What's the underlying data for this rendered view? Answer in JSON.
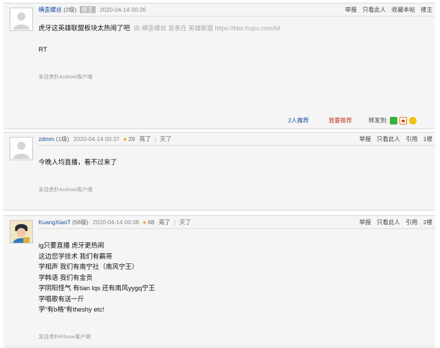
{
  "posts": [
    {
      "username": "横歪螺丝",
      "level": "(2级)",
      "badge": "楼主",
      "time": "2020-04-14 00:26",
      "ops": [
        "举报",
        "只看此人",
        "收藏本帖",
        "楼主"
      ],
      "title": "虎牙这英雄联盟板块太热闹了吧",
      "via": "由 横歪螺丝 发表在 英雄联盟 https://bbs.hupu.com/lol",
      "content": [
        "RT"
      ],
      "device": "发自虎扑Android客户端",
      "recommend_count": "2人推荐",
      "want_recommend": "我要推荐",
      "share_label": "转发到:",
      "share_icons": [
        "wechat-icon",
        "weibo-icon",
        "qzone-icon"
      ]
    },
    {
      "username": "zdmm",
      "level": "(1级)",
      "time": "2020-04-14 00:37",
      "light_count": "29",
      "light_label": "亮了",
      "dim_label": "灭了",
      "ops": [
        "举报",
        "只看此人",
        "引用",
        "1楼"
      ],
      "content": [
        "今晚人均直播，看不过来了"
      ],
      "device": "发自虎扑Android客户端"
    },
    {
      "username": "KuangXiaoT",
      "level": "(56级)",
      "time": "2020-04-14 00:38",
      "light_count": "68",
      "light_label": "亮了",
      "dim_label": "灭了",
      "ops": [
        "举报",
        "只看此人",
        "引用",
        "2楼"
      ],
      "content": [
        "ig只要直播 虎牙更热闹",
        "这边您学技术 我们有霸哥",
        "学相声 我们有南宁社（南风宁王）",
        "学韩语 我们有金贡",
        "学阴阳怪气 有tian lqs 还有南风yygq宁王",
        "学唱歌有送一斤",
        "学“有b格”有theshy etc!"
      ],
      "device": "发自虎扑iPhone客户端"
    }
  ]
}
